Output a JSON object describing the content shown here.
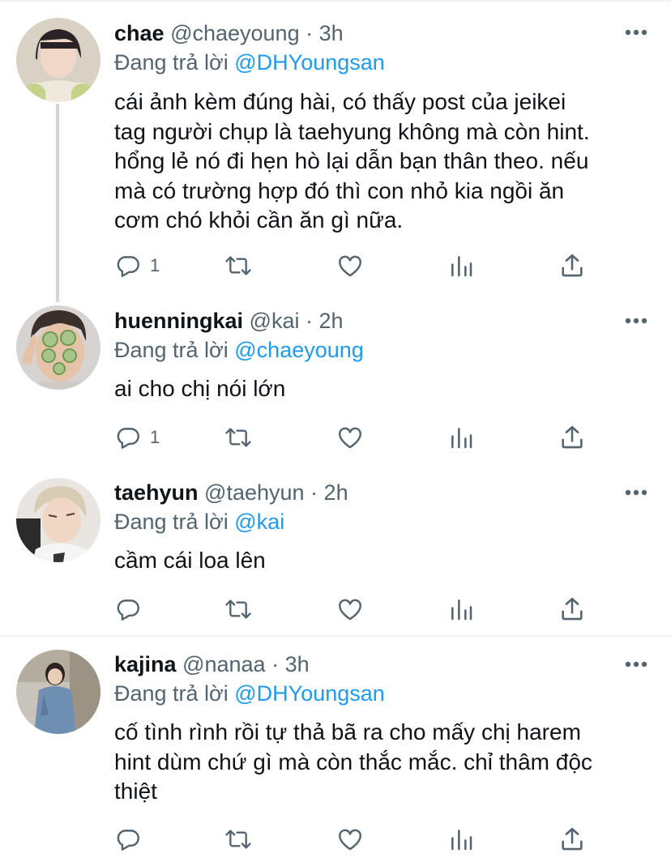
{
  "reply_prefix": "Đang trả lời ",
  "dot": " · ",
  "tweets": [
    {
      "name": "chae",
      "handle": "@chaeyoung",
      "time": "3h",
      "reply_to": "@DHYoungsan",
      "text_lines": [
        "cái ảnh kèm đúng hài, có thấy post của jeikei",
        "tag người chụp là taehyung không mà còn hint.",
        "hổng lẻ nó đi hẹn hò lại dẫn bạn thân theo. nếu",
        "mà có trường hợp đó thì con nhỏ kia ngồi ăn",
        "cơm chó khỏi cần ăn gì nữa."
      ],
      "reply_count": "1"
    },
    {
      "name": "huenningkai",
      "handle": "@kai",
      "time": "2h",
      "reply_to": "@chaeyoung",
      "text_lines": [
        "ai cho chị nói lớn"
      ],
      "reply_count": "1"
    },
    {
      "name": "taehyun",
      "handle": "@taehyun",
      "time": "2h",
      "reply_to": "@kai",
      "text_lines": [
        "cầm cái loa lên"
      ],
      "reply_count": ""
    },
    {
      "name": "kajina",
      "handle": "@nanaa",
      "time": "3h",
      "reply_to": "@DHYoungsan",
      "text_lines": [
        "cố tình rình rồi tự thả bã ra cho mấy chị harem",
        "hint dùm chứ gì mà còn thắc mắc. chỉ thâm độc",
        "thiệt"
      ],
      "reply_count": ""
    }
  ],
  "icons": {
    "reply": "reply-icon",
    "retweet": "retweet-icon",
    "like": "heart-icon",
    "analytics": "analytics-icon",
    "share": "share-icon",
    "more": "more-icon"
  },
  "colors": {
    "text": "#0f1419",
    "secondary": "#536471",
    "mention": "#1d9bf0",
    "thread_line": "#cfd9de"
  }
}
